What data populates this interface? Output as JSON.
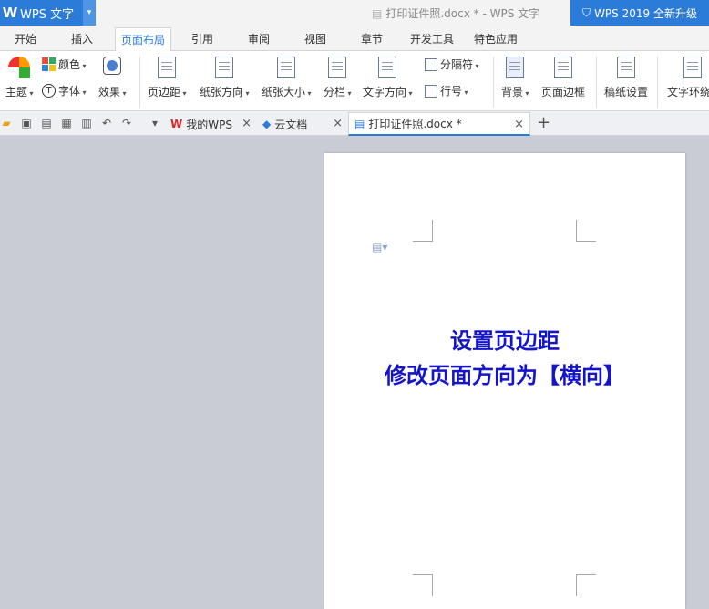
{
  "app": {
    "name": "WPS 文字",
    "doc_title": "打印证件照.docx * - WPS 文字",
    "upgrade": "WPS 2019 全新升级"
  },
  "menu": [
    "开始",
    "插入",
    "页面布局",
    "引用",
    "审阅",
    "视图",
    "章节",
    "开发工具",
    "特色应用"
  ],
  "ribbon": {
    "theme": "主题",
    "color": "颜色",
    "font": "字体",
    "effect": "效果",
    "margin": "页边距",
    "orientation": "纸张方向",
    "size": "纸张大小",
    "columns": "分栏",
    "text_direction": "文字方向",
    "separator": "分隔符",
    "line_no": "行号",
    "background": "背景",
    "page_border": "页面边框",
    "paper_setting": "稿纸设置",
    "wrap": "文字环绕"
  },
  "tabs": {
    "mywps": "我的WPS",
    "cloud": "云文档",
    "doc": "打印证件照.docx *"
  },
  "page": {
    "line1": "设置页边距",
    "line2": "修改页面方向为【横向】"
  }
}
